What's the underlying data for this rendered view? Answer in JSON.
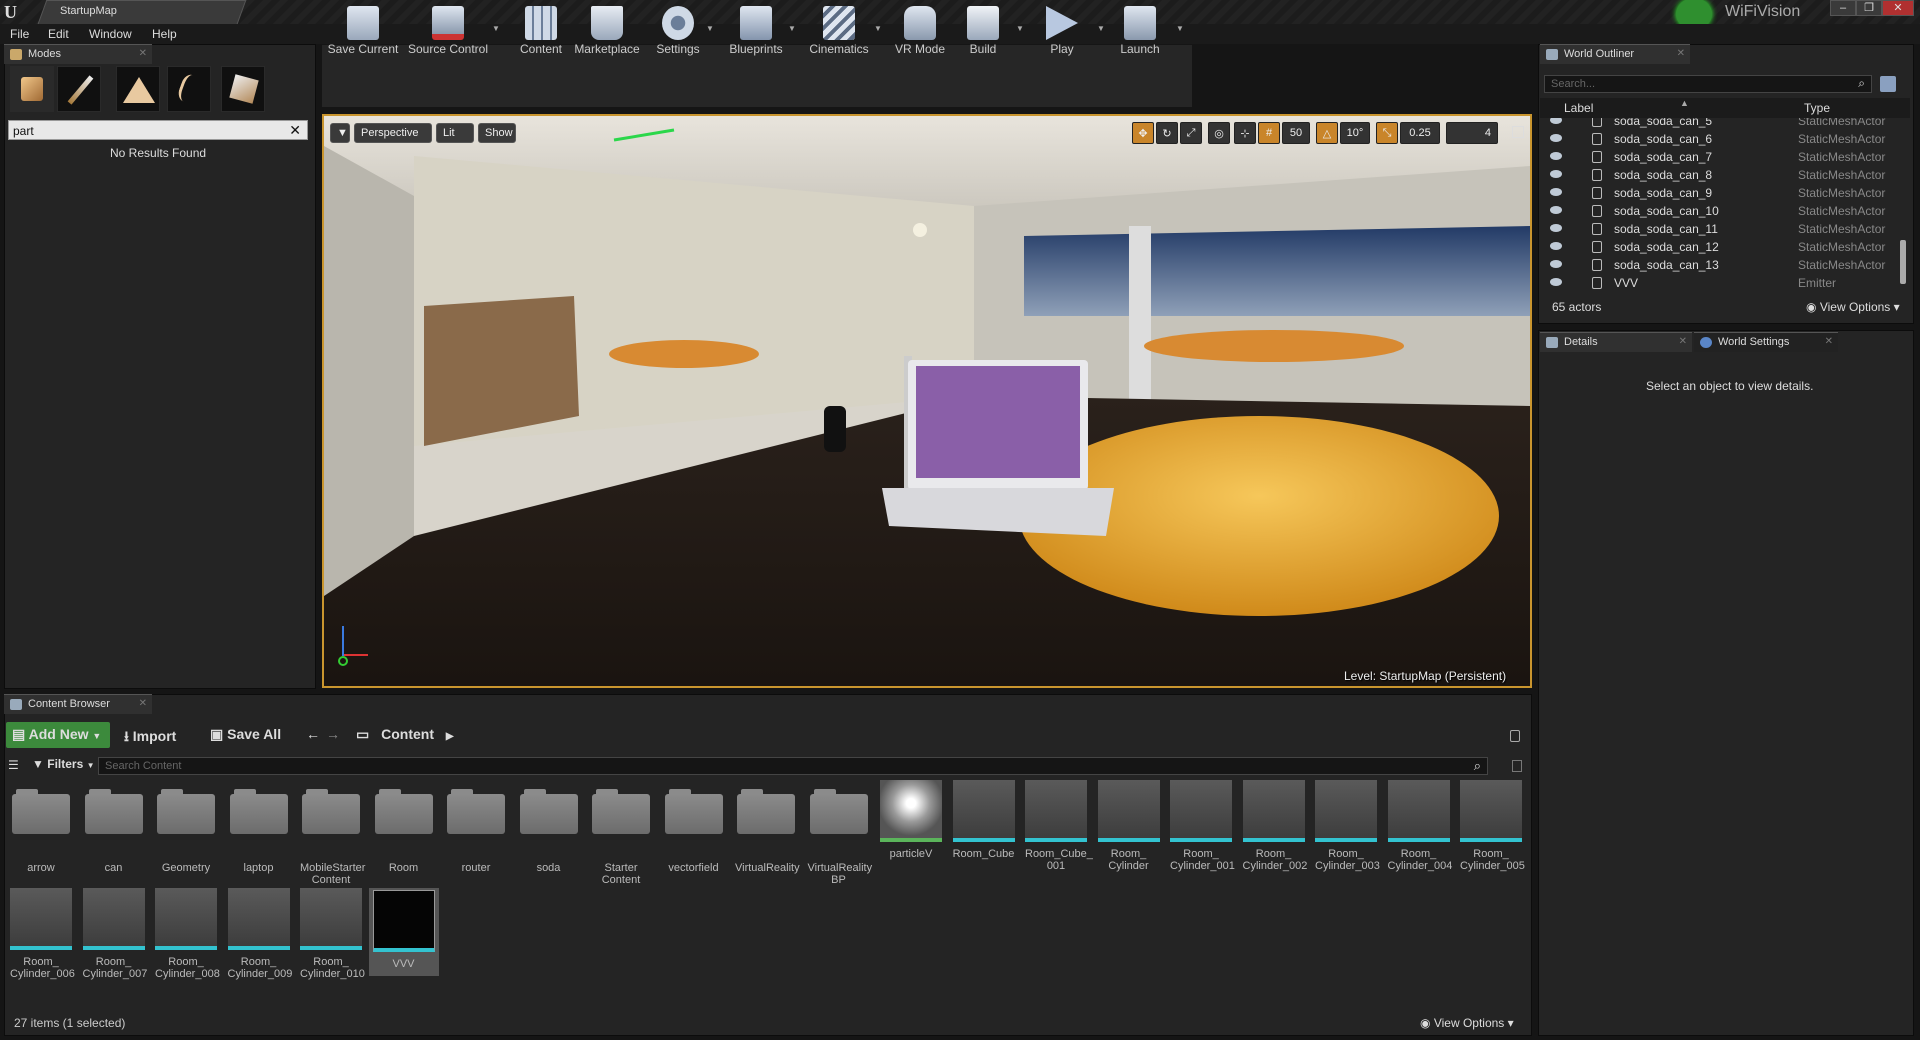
{
  "window": {
    "tab_title": "StartupMap",
    "brand": "WiFiVision",
    "controls": [
      "–",
      "❐",
      "✕"
    ]
  },
  "menu": [
    "File",
    "Edit",
    "Window",
    "Help"
  ],
  "modes": {
    "tab": "Modes",
    "search_value": "part",
    "clear_symbol": "✕",
    "no_results": "No Results Found",
    "tools": [
      "place-icon",
      "paint-icon",
      "landscape-icon",
      "foliage-icon",
      "geometry-icon"
    ]
  },
  "toolbar": {
    "buttons": [
      {
        "label": "Save Current",
        "icon": "save-icon"
      },
      {
        "label": "Source Control",
        "icon": "source-control-icon"
      },
      {
        "label": "Content",
        "icon": "content-icon"
      },
      {
        "label": "Marketplace",
        "icon": "marketplace-icon"
      },
      {
        "label": "Settings",
        "icon": "settings-icon"
      },
      {
        "label": "Blueprints",
        "icon": "blueprints-icon"
      },
      {
        "label": "Cinematics",
        "icon": "cinematics-icon"
      },
      {
        "label": "VR Mode",
        "icon": "vr-icon"
      },
      {
        "label": "Build",
        "icon": "build-icon"
      },
      {
        "label": "Play",
        "icon": "play-icon"
      },
      {
        "label": "Launch",
        "icon": "launch-icon"
      }
    ],
    "dropdown_arrow": "▼"
  },
  "viewport": {
    "dropdown": "▼",
    "perspective": "Perspective",
    "lit": "Lit",
    "show": "Show",
    "grid_snap": "50",
    "rotation_snap": "10°",
    "scale_snap": "0.25",
    "camera_speed": "4",
    "level_prefix": "Level:",
    "level_name": "StartupMap (Persistent)"
  },
  "outliner": {
    "tab": "World Outliner",
    "search_placeholder": "Search...",
    "col_label": "Label",
    "col_type": "Type",
    "rows": [
      {
        "label": "soda_soda_can_5",
        "type": "StaticMeshActor"
      },
      {
        "label": "soda_soda_can_6",
        "type": "StaticMeshActor"
      },
      {
        "label": "soda_soda_can_7",
        "type": "StaticMeshActor"
      },
      {
        "label": "soda_soda_can_8",
        "type": "StaticMeshActor"
      },
      {
        "label": "soda_soda_can_9",
        "type": "StaticMeshActor"
      },
      {
        "label": "soda_soda_can_10",
        "type": "StaticMeshActor"
      },
      {
        "label": "soda_soda_can_11",
        "type": "StaticMeshActor"
      },
      {
        "label": "soda_soda_can_12",
        "type": "StaticMeshActor"
      },
      {
        "label": "soda_soda_can_13",
        "type": "StaticMeshActor"
      },
      {
        "label": "VVV",
        "type": "Emitter"
      }
    ],
    "count": "65 actors",
    "view_options": "View Options"
  },
  "details": {
    "tab_details": "Details",
    "tab_world_settings": "World Settings",
    "empty_message": "Select an object to view details."
  },
  "content_browser": {
    "tab": "Content Browser",
    "add_new": "Add New",
    "import": "Import",
    "save_all": "Save All",
    "path": "Content",
    "filters": "Filters",
    "search_placeholder": "Search Content",
    "status": "27 items (1 selected)",
    "view_options": "View Options",
    "folders": [
      "arrow",
      "can",
      "Geometry",
      "laptop",
      "MobileStarter Content",
      "Room",
      "router",
      "soda",
      "Starter Content",
      "vectorfield",
      "VirtualReality",
      "VirtualReality BP"
    ],
    "assets": [
      "particleV",
      "Room_Cube",
      "Room_Cube_ 001",
      "Room_ Cylinder",
      "Room_ Cylinder_001",
      "Room_ Cylinder_002",
      "Room_ Cylinder_003",
      "Room_ Cylinder_004",
      "Room_ Cylinder_005",
      "Room_ Cylinder_006",
      "Room_ Cylinder_007",
      "Room_ Cylinder_008",
      "Room_ Cylinder_009",
      "Room_ Cylinder_010",
      "VVV"
    ]
  }
}
